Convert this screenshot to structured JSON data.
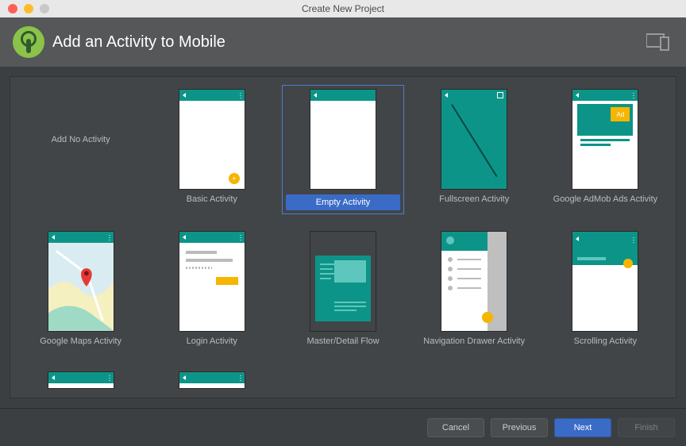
{
  "window_title": "Create New Project",
  "header": {
    "title": "Add an Activity to Mobile"
  },
  "templates": [
    {
      "id": "add-no-activity",
      "label": "Add No Activity",
      "kind": "none",
      "selected": false
    },
    {
      "id": "basic-activity",
      "label": "Basic Activity",
      "kind": "basic",
      "selected": false
    },
    {
      "id": "empty-activity",
      "label": "Empty Activity",
      "kind": "empty",
      "selected": true
    },
    {
      "id": "fullscreen-activity",
      "label": "Fullscreen Activity",
      "kind": "fullscreen",
      "selected": false
    },
    {
      "id": "admob-activity",
      "label": "Google AdMob Ads Activity",
      "kind": "admob",
      "selected": false,
      "ad_text": "Ad"
    },
    {
      "id": "maps-activity",
      "label": "Google Maps Activity",
      "kind": "maps",
      "selected": false
    },
    {
      "id": "login-activity",
      "label": "Login Activity",
      "kind": "login",
      "selected": false
    },
    {
      "id": "master-detail",
      "label": "Master/Detail Flow",
      "kind": "masterdetail",
      "selected": false
    },
    {
      "id": "nav-drawer",
      "label": "Navigation Drawer Activity",
      "kind": "navdrawer",
      "selected": false
    },
    {
      "id": "scrolling-activity",
      "label": "Scrolling Activity",
      "kind": "scrolling",
      "selected": false
    }
  ],
  "footer": {
    "cancel": "Cancel",
    "previous": "Previous",
    "next": "Next",
    "finish": "Finish"
  }
}
